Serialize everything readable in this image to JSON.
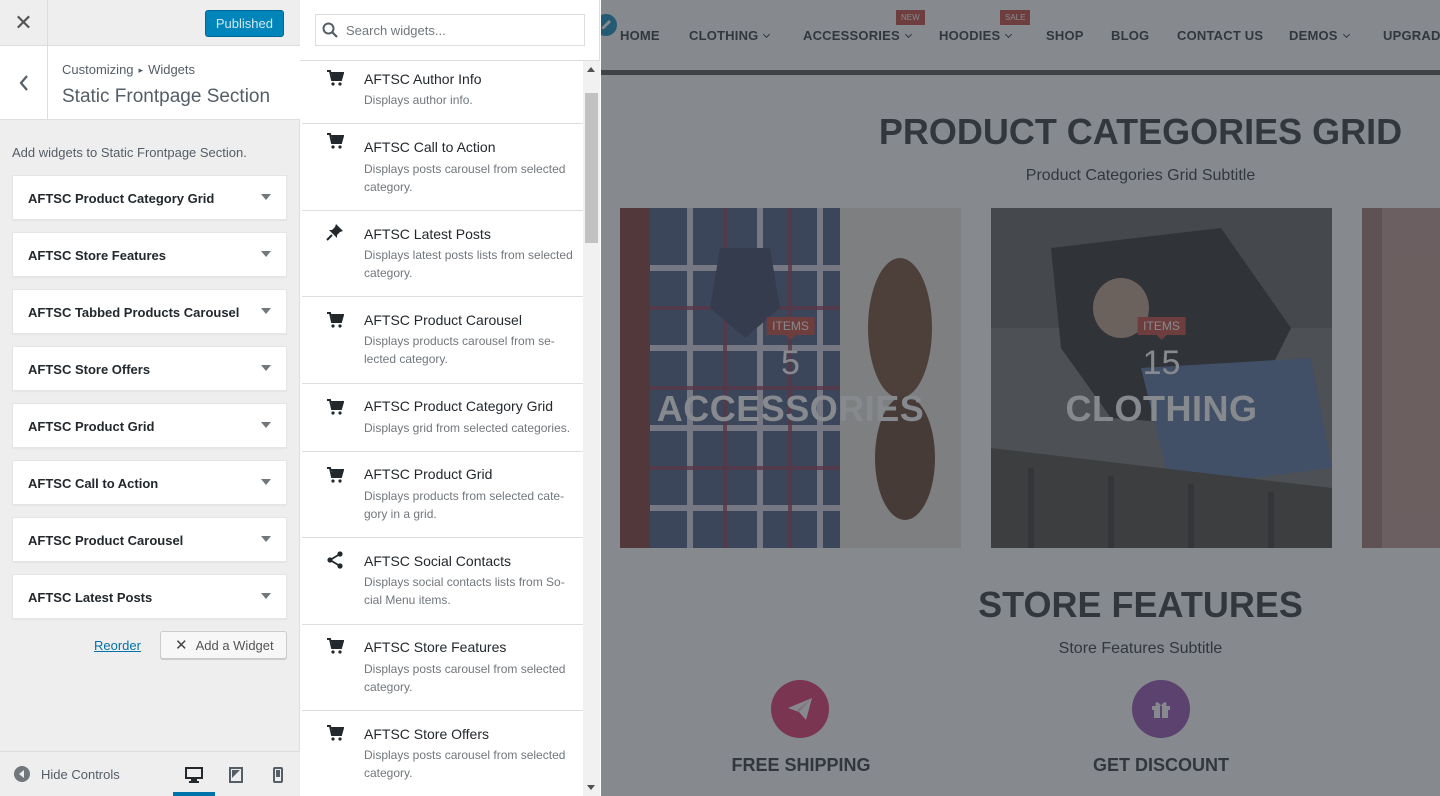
{
  "header": {
    "publish_label": "Published"
  },
  "section": {
    "breadcrumb_parent": "Customizing",
    "breadcrumb_child": "Widgets",
    "title": "Static Frontpage Section",
    "description": "Add widgets to Static Frontpage Section."
  },
  "widgets": [
    "AFTSC Product Category Grid",
    "AFTSC Store Features",
    "AFTSC Tabbed Products Carousel",
    "AFTSC Store Offers",
    "AFTSC Product Grid",
    "AFTSC Call to Action",
    "AFTSC Product Carousel",
    "AFTSC Latest Posts"
  ],
  "actions": {
    "reorder_label": "Reorder",
    "add_widget_label": "Add a Widget"
  },
  "footer": {
    "hide_controls_label": "Hide Controls"
  },
  "search": {
    "placeholder": "Search widgets..."
  },
  "available_widgets": [
    {
      "icon": "cart-icon",
      "title": "AFTSC Author Info",
      "desc": "Displays author info."
    },
    {
      "icon": "cart-icon",
      "title": "AFTSC Call to Action",
      "desc": "Displays posts carousel from selected category."
    },
    {
      "icon": "pin-icon",
      "title": "AFTSC Latest Posts",
      "desc": "Displays latest posts lists from selected category."
    },
    {
      "icon": "cart-icon",
      "title": "AFTSC Product Carousel",
      "desc": "Displays products carousel from se-lected category."
    },
    {
      "icon": "cart-icon",
      "title": "AFTSC Product Category Grid",
      "desc": "Displays grid from selected categories."
    },
    {
      "icon": "cart-icon",
      "title": "AFTSC Product Grid",
      "desc": "Displays products from selected cate-gory in a grid."
    },
    {
      "icon": "share-icon",
      "title": "AFTSC Social Contacts",
      "desc": "Displays social contacts lists from So-cial Menu items."
    },
    {
      "icon": "cart-icon",
      "title": "AFTSC Store Features",
      "desc": "Displays posts carousel from selected category."
    },
    {
      "icon": "cart-icon",
      "title": "AFTSC Store Offers",
      "desc": "Displays posts carousel from selected category."
    }
  ],
  "preview": {
    "nav": [
      {
        "label": "HOME",
        "chevron": false
      },
      {
        "label": "CLOTHING",
        "chevron": true
      },
      {
        "label": "ACCESSORIES",
        "chevron": true,
        "badge": "NEW"
      },
      {
        "label": "HOODIES",
        "chevron": true,
        "badge": "SALE"
      },
      {
        "label": "SHOP",
        "chevron": false
      },
      {
        "label": "BLOG",
        "chevron": false
      },
      {
        "label": "CONTACT US",
        "chevron": false
      },
      {
        "label": "DEMOS",
        "chevron": true
      },
      {
        "label": "UPGRADE",
        "chevron": false
      }
    ],
    "categories_title": "PRODUCT CATEGORIES GRID",
    "categories_subtitle": "Product Categories Grid Subtitle",
    "categories": [
      {
        "badge": "ITEMS",
        "count": "5",
        "name": "ACCESSORIES"
      },
      {
        "badge": "ITEMS",
        "count": "15",
        "name": "CLOTHING"
      }
    ],
    "features_title": "STORE FEATURES",
    "features_subtitle": "Store Features Subtitle",
    "features": [
      {
        "label": "FREE SHIPPING",
        "icon": "paper-plane-icon",
        "color": "#e0245e"
      },
      {
        "label": "GET DISCOUNT",
        "icon": "gift-icon",
        "color": "#8e44ad"
      }
    ]
  },
  "colors": {
    "accent": "#0085ba",
    "link": "#0073aa",
    "badge": "#c0392b"
  }
}
